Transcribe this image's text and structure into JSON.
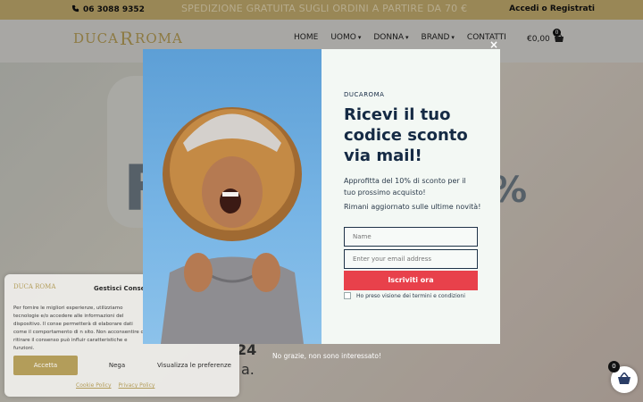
{
  "topbar": {
    "phone": "06 3088 9352",
    "promo": "SPEDIZIONE GRATUITA SUGLI ORDINI A PARTIRE DA 70 €",
    "login": "Accedi o Registrati"
  },
  "header": {
    "logo_left": "DUCA",
    "logo_mark": "R",
    "logo_right": "ROMA",
    "nav": [
      "HOME",
      "UOMO",
      "DONNA",
      "BRAND",
      "CONTATTI"
    ],
    "cart_total": "€0,00",
    "cart_count": "0"
  },
  "hero": {
    "big_letter": "F",
    "big_pct": "%",
    "frag1": "24",
    "frag2": "a."
  },
  "popup": {
    "brand": "DUCAROMA",
    "headline": "Ricevi il tuo codice sconto via mail!",
    "body1": "Approfitta del 10% di sconto per il tuo prossimo acquisto!",
    "body2": "Rimani aggiornato sulle ultime novità!",
    "name_placeholder": "Name",
    "email_placeholder": "Enter your email address",
    "submit_label": "Iscriviti ora",
    "consent_label": "Ho preso visione dei termini e condizioni",
    "close_label": "×",
    "no_thanks": "No grazie, non sono interessato!"
  },
  "cookie": {
    "logo": "DUCA ROMA",
    "title": "Gestisci Consen",
    "text": "Per fornire le migliori esperienze, utilizziamo tecnologie e/o accedere alle informazioni del dispositivo. Il conse permetterà di elaborare dati come il comportamento di n sito. Non acconsentire o ritirare il consenso può influir caratteristiche e funzioni.",
    "accept": "Accetta",
    "deny": "Nega",
    "prefs": "Visualizza le preferenze",
    "cookie_policy": "Cookie Policy",
    "privacy_policy": "Privacy Policy"
  },
  "floating_cart": {
    "count": "0"
  },
  "colors": {
    "gold": "#c5ad6f",
    "navy": "#152a44",
    "cta_red": "#e8414b",
    "popup_bg": "#f3f8f4"
  }
}
